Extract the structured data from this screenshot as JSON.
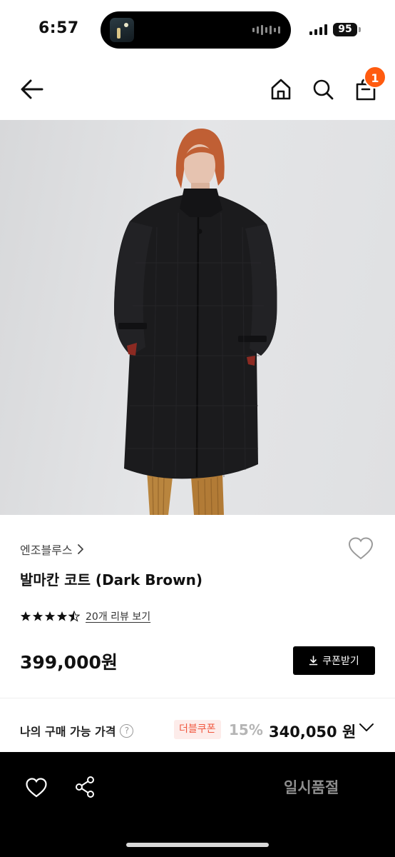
{
  "status_bar": {
    "time": "6:57",
    "battery": "95"
  },
  "nav": {
    "cart_count": "1"
  },
  "product": {
    "brand": "엔조블루스",
    "title": "발마칸 코트 (Dark Brown)",
    "rating": 4.5,
    "review_link": "20개 리뷰 보기",
    "price": "399,000원",
    "coupon_button": "쿠폰받기"
  },
  "my_price": {
    "label": "나의 구매 가능 가격",
    "help": "?",
    "coupon_tag": "더블쿠폰",
    "discount": "15%",
    "final_price": "340,050 원"
  },
  "bottom_bar": {
    "status_button": "일시품절"
  },
  "colors": {
    "badge": "#ff5b0f",
    "coupon_tag_bg": "#fdecea",
    "coupon_tag_text": "#f0573f",
    "bottom_bar": "#000000"
  }
}
